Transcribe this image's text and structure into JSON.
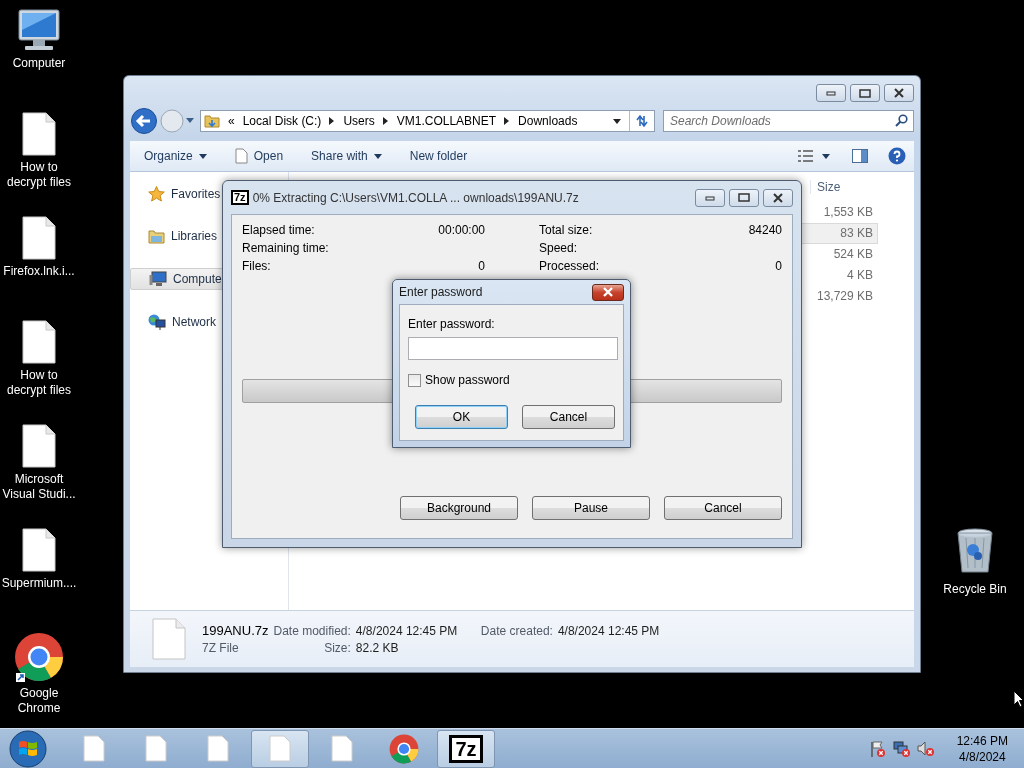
{
  "desktop_icons": [
    {
      "label": "Computer",
      "kind": "computer"
    },
    {
      "label": "How to decrypt files",
      "kind": "document"
    },
    {
      "label": "Firefox.lnk.i...",
      "kind": "document"
    },
    {
      "label": "How to decrypt files",
      "kind": "document"
    },
    {
      "label": "Microsoft Visual Studi...",
      "kind": "document"
    },
    {
      "label": "Supermium....",
      "kind": "document"
    },
    {
      "label": "Google Chrome",
      "kind": "chrome"
    }
  ],
  "recycle_bin": {
    "label": "Recycle Bin"
  },
  "explorer": {
    "address_prefix": "«",
    "address": [
      "Local Disk (C:)",
      "Users",
      "VM1.COLLABNET",
      "Downloads"
    ],
    "search": {
      "placeholder": "Search Downloads"
    },
    "toolbar": [
      {
        "label": "Organize",
        "kind": "menu"
      },
      {
        "label": "Open",
        "kind": "open"
      },
      {
        "label": "Share with",
        "kind": "menu"
      },
      {
        "label": "New folder",
        "kind": "plain"
      }
    ],
    "nav": [
      {
        "label": "Favorites",
        "kind": "favorites",
        "selected": false
      },
      {
        "label": "Libraries",
        "kind": "libraries",
        "selected": false
      },
      {
        "label": "Compute",
        "kind": "computer",
        "selected": true
      },
      {
        "label": "Network",
        "kind": "network",
        "selected": false
      }
    ],
    "columns": [
      "Size"
    ],
    "rows": [
      {
        "size": "1,553 KB",
        "selected": false
      },
      {
        "size": "83 KB",
        "selected": true
      },
      {
        "size": "524 KB",
        "selected": false
      },
      {
        "size": "4 KB",
        "selected": false
      },
      {
        "size": "13,729 KB",
        "selected": false
      }
    ],
    "details": {
      "name": "199ANU.7z",
      "type": "7Z File",
      "fields": [
        {
          "label": "Date modified:",
          "value": "4/8/2024 12:45 PM"
        },
        {
          "label": "Date created:",
          "value": "4/8/2024 12:45 PM"
        },
        {
          "label": "Size:",
          "value": "82.2 KB"
        }
      ]
    }
  },
  "extract_dialog": {
    "logo": "7z",
    "title": "0% Extracting C:\\Users\\VM1.COLLA ... ownloads\\199ANU.7z",
    "stats": [
      {
        "label": "Elapsed time:",
        "value": "00:00:00"
      },
      {
        "label": "Total size:",
        "value": "84240"
      },
      {
        "label": "Remaining time:"
      },
      {
        "label": "Speed:"
      },
      {
        "label": "Files:",
        "value": "0"
      },
      {
        "label": "Processed:",
        "value": "0"
      }
    ],
    "progress": {
      "level": 0
    },
    "buttons": [
      "Background",
      "Pause",
      "Cancel"
    ]
  },
  "password_dialog": {
    "title": "Enter password",
    "label": "Enter password:",
    "show_password": {
      "label": "Show password",
      "checked": false
    },
    "buttons": [
      {
        "label": "OK",
        "default": true
      },
      {
        "label": "Cancel",
        "default": false
      }
    ]
  },
  "taskbar": {
    "items": [
      {
        "kind": "document",
        "active": false
      },
      {
        "kind": "document",
        "active": false
      },
      {
        "kind": "document",
        "active": false
      },
      {
        "kind": "document",
        "active": true
      },
      {
        "kind": "document",
        "active": false
      },
      {
        "kind": "chrome",
        "active": false
      },
      {
        "kind": "archiver",
        "text": "7z",
        "active": true
      }
    ],
    "clock": {
      "time": "12:46 PM",
      "date": "4/8/2024"
    }
  }
}
